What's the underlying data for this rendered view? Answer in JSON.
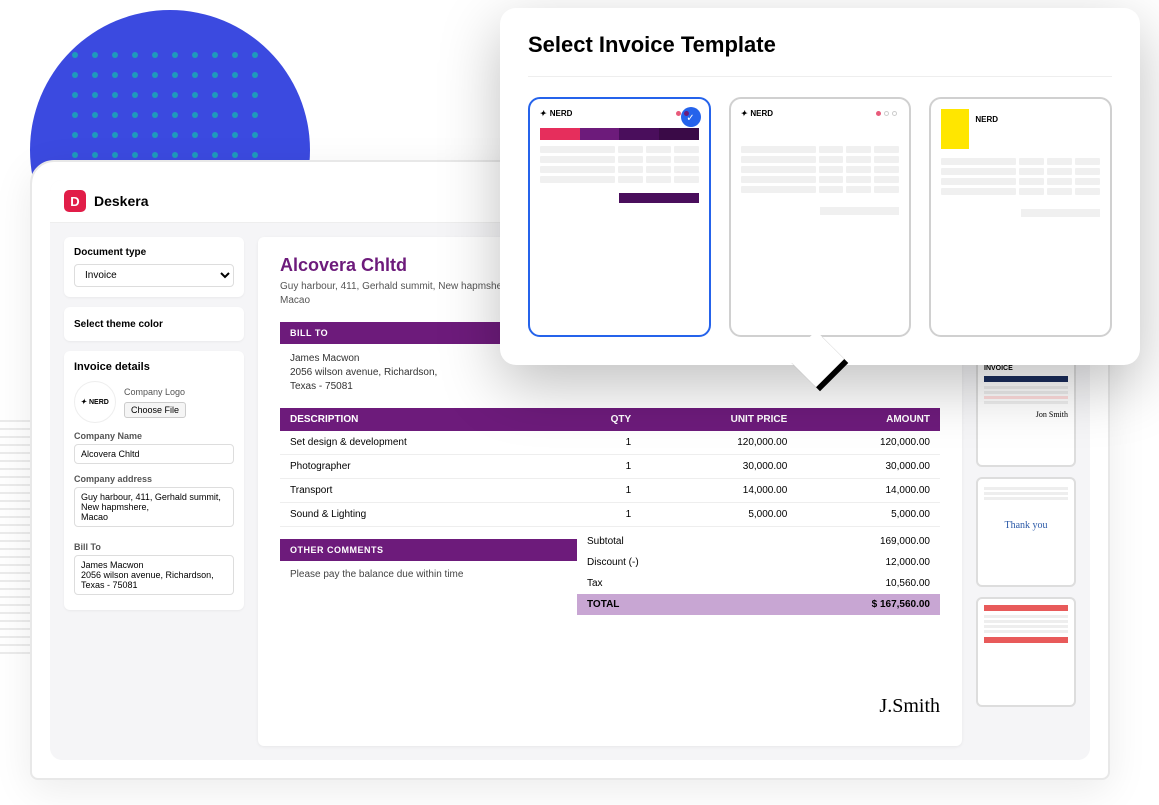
{
  "brand": "Deskera",
  "sidebar": {
    "doc_type_label": "Document type",
    "doc_type_value": "Invoice",
    "theme_label": "Select theme color",
    "theme_color": "#6d1b7b",
    "details_title": "Invoice details",
    "company_logo_label": "Company Logo",
    "choose_file": "Choose File",
    "logo_text": "NERD",
    "company_name_label": "Company Name",
    "company_name_value": "Alcovera Chltd",
    "company_addr_label": "Company address",
    "company_addr_value": "Guy harbour, 411, Gerhald summit, New hapmshere,\nMacao",
    "bill_to_label": "Bill To",
    "bill_to_value": "James Macwon\n2056 wilson avenue, Richardson,\nTexas - 75081"
  },
  "invoice": {
    "company": "Alcovera Chltd",
    "address": "Guy harbour, 411, Gerhald summit, New hapmshere,\nMacao",
    "bill_to_header": "BILL TO",
    "bill_to": "James Macwon\n2056 wilson avenue, Richardson,\nTexas - 75081",
    "cols": {
      "desc": "DESCRIPTION",
      "qty": "QTY",
      "price": "UNIT PRICE",
      "amount": "AMOUNT"
    },
    "items": [
      {
        "desc": "Set design & development",
        "qty": "1",
        "price": "120,000.00",
        "amount": "120,000.00"
      },
      {
        "desc": "Photographer",
        "qty": "1",
        "price": "30,000.00",
        "amount": "30,000.00"
      },
      {
        "desc": "Transport",
        "qty": "1",
        "price": "14,000.00",
        "amount": "14,000.00"
      },
      {
        "desc": "Sound & Lighting",
        "qty": "1",
        "price": "5,000.00",
        "amount": "5,000.00"
      }
    ],
    "totals": {
      "subtotal_label": "Subtotal",
      "subtotal": "169,000.00",
      "discount_label": "Discount (-)",
      "discount": "12,000.00",
      "tax_label": "Tax",
      "tax": "10,560.00",
      "total_label": "TOTAL",
      "total": "$ 167,560.00"
    },
    "comments_header": "OTHER COMMENTS",
    "comments": "Please pay the balance due within time",
    "signature": "J.Smith"
  },
  "modal": {
    "title": "Select Invoice Template",
    "tpl_logo": "NERD"
  },
  "right_thumbs": {
    "t2_title": "INVOICE",
    "t3_text": "Thank you"
  }
}
